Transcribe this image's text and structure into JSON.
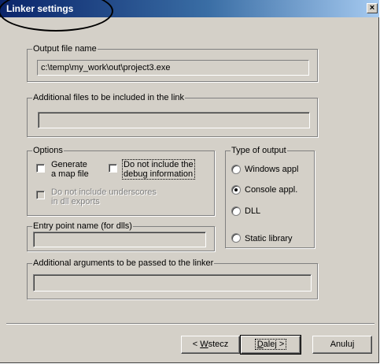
{
  "dialog": {
    "title": "Linker settings",
    "close_glyph": "×"
  },
  "output_file": {
    "group_label": "Output file name",
    "value": "c:\\temp\\my_work\\out\\project3.exe"
  },
  "additional_files": {
    "group_label": "Additional files to be included in the link",
    "value": ""
  },
  "options": {
    "group_label": "Options",
    "generate_map_line1": "Generate",
    "generate_map_line2": "a map file",
    "no_debug_line1": "Do not include the",
    "no_debug_line2": "debug information",
    "no_underscores_line1": "Do not include underscores",
    "no_underscores_line2": "in dll exports",
    "generate_map_checked": false,
    "no_debug_checked": false,
    "no_underscores_checked": false
  },
  "output_type": {
    "group_label": "Type of output",
    "options": [
      "Windows appl",
      "Console appl.",
      "DLL",
      "Static library"
    ],
    "selected": "Console appl."
  },
  "entry_point": {
    "group_label": "Entry point name (for dlls)",
    "value": ""
  },
  "linker_args": {
    "group_label": "Additional arguments to be passed to the linker",
    "value": ""
  },
  "buttons": {
    "back_prefix": "< ",
    "back_mnemonic": "W",
    "back_rest": "stecz",
    "next_mnemonic": "D",
    "next_rest": "alej >",
    "cancel": "Anuluj"
  }
}
